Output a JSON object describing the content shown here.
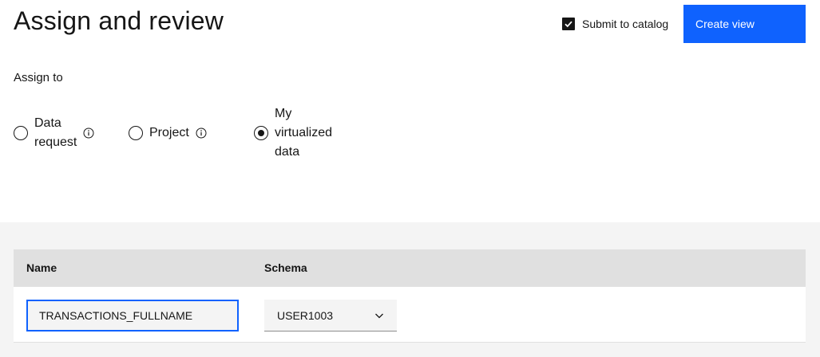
{
  "header": {
    "title": "Assign and review",
    "submit_checkbox": {
      "label": "Submit to catalog",
      "checked": true
    },
    "create_button": "Create view"
  },
  "assign": {
    "label": "Assign to",
    "options": [
      {
        "lines": [
          "Data",
          "request"
        ],
        "selected": false,
        "info_icon": "information-icon"
      },
      {
        "lines": [
          "Project"
        ],
        "selected": false,
        "info_icon": "information-icon"
      },
      {
        "lines": [
          "My",
          "virtualized",
          "data"
        ],
        "selected": true
      }
    ]
  },
  "table": {
    "columns": [
      "Name",
      "Schema"
    ],
    "row": {
      "name_value": "TRANSACTIONS_FULLNAME",
      "schema_value": "USER1003",
      "schema_icon": "chevron-down-icon"
    }
  },
  "colors": {
    "accent": "#0f62fe",
    "gray_bg": "#f4f4f4",
    "header_bg": "#e0e0e0",
    "text": "#161616"
  }
}
